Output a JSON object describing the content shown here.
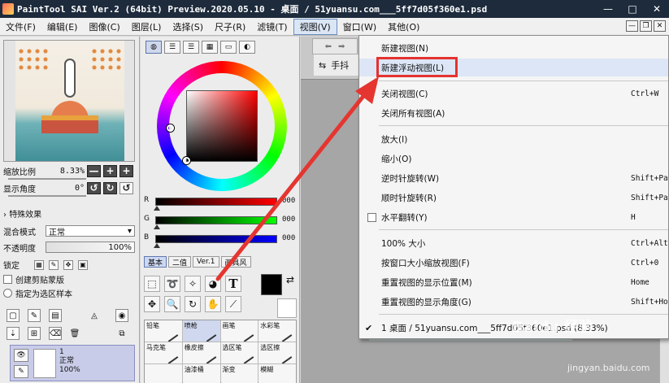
{
  "window": {
    "title": "PaintTool SAI Ver.2 (64bit) Preview.2020.05.10 - 桌面 / 51yuansu.com___5ff7d05f360e1.psd",
    "controls": [
      "—",
      "□",
      "✕"
    ]
  },
  "menubar": {
    "items": [
      "文件(F)",
      "编辑(E)",
      "图像(C)",
      "图层(L)",
      "选择(S)",
      "尺子(R)",
      "滤镜(T)",
      "视图(V)",
      "窗口(W)",
      "其他(O)"
    ],
    "active": "视图(V)",
    "mini_controls": [
      "—",
      "❐",
      "✕"
    ]
  },
  "navigator": {
    "zoom_label": "缩放比例",
    "zoom_value": "8.33%",
    "angle_label": "显示角度",
    "angle_value": "0°",
    "buttons": [
      "—",
      "+",
      "+"
    ],
    "rotate_buttons": [
      "↺",
      "↻"
    ],
    "reset_button": "↺"
  },
  "layer_props": {
    "section_title": "特殊效果",
    "blend_label": "混合模式",
    "blend_value": "正常",
    "opacity_label": "不透明度",
    "opacity_value": "100%",
    "lock_label": "锁定",
    "clip_label": "创建剪贴蒙版",
    "sample_label": "指定为选区样本"
  },
  "layer": {
    "name": "1",
    "mode": "正常",
    "opacity": "100%"
  },
  "color_panel": {
    "channels": [
      {
        "name": "R",
        "value": "000"
      },
      {
        "name": "G",
        "value": "000"
      },
      {
        "name": "B",
        "value": "000"
      }
    ],
    "sub_tabs": [
      "基本",
      "二值",
      "Ver.1",
      "画具风"
    ],
    "brushes": [
      "铅笔",
      "喷枪",
      "画笔",
      "水彩笔",
      "马克笔",
      "橡皮擦",
      "选区笔",
      "选区擦",
      "",
      "油漆桶",
      "渐变",
      "模糊"
    ]
  },
  "canvas": {
    "tab_label": "手抖"
  },
  "view_menu": {
    "items": [
      {
        "label": "新建视图(N)",
        "shortcut": ""
      },
      {
        "label": "新建浮动视图(L)",
        "shortcut": ""
      },
      {
        "label": "关闭视图(C)",
        "shortcut": "Ctrl+W"
      },
      {
        "label": "关闭所有视图(A)",
        "shortcut": ""
      },
      {
        "label": "放大(I)",
        "shortcut": ""
      },
      {
        "label": "缩小(O)",
        "shortcut": ""
      },
      {
        "label": "逆时针旋转(W)",
        "shortcut": "Shift+Pa"
      },
      {
        "label": "顺时针旋转(R)",
        "shortcut": "Shift+Pa"
      },
      {
        "label": "水平翻转(Y)",
        "shortcut": "H"
      },
      {
        "label": "100% 大小",
        "shortcut": "Ctrl+Alt"
      },
      {
        "label": "按窗口大小缩放视图(F)",
        "shortcut": "Ctrl+0"
      },
      {
        "label": "重置视图的显示位置(M)",
        "shortcut": "Home"
      },
      {
        "label": "重置视图的显示角度(G)",
        "shortcut": "Shift+Ho"
      },
      {
        "label": "1 桌面 / 51yuansu.com___5ff7d05f360e1.psd (8.33%)",
        "shortcut": ""
      }
    ]
  },
  "watermark": {
    "brand": "Baidu 经验",
    "url": "jingyan.baidu.com"
  },
  "colors": {
    "titlebar": "#1d2b3c",
    "highlight_border": "#e5322f",
    "arrow": "#e53530"
  }
}
